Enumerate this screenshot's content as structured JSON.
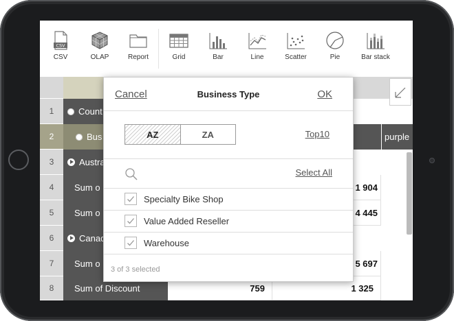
{
  "toolbar": {
    "items": [
      {
        "label": "CSV",
        "icon": "csv-icon"
      },
      {
        "label": "OLAP",
        "icon": "cube-icon"
      },
      {
        "label": "Report",
        "icon": "folder-icon"
      },
      {
        "label": "Grid",
        "icon": "grid-icon"
      },
      {
        "label": "Bar",
        "icon": "bar-chart-icon"
      },
      {
        "label": "Line",
        "icon": "line-chart-icon"
      },
      {
        "label": "Scatter",
        "icon": "scatter-chart-icon"
      },
      {
        "label": "Pie",
        "icon": "pie-chart-icon"
      },
      {
        "label": "Bar stack",
        "icon": "bar-stack-icon"
      }
    ]
  },
  "grid": {
    "row_numbers": [
      "1",
      "2",
      "3",
      "4",
      "5",
      "6",
      "7",
      "8"
    ],
    "row1_label": "Count",
    "row2_label": "Bus",
    "row3_label": "Austra",
    "row4_label": "Sum o",
    "row5_label": "Sum o",
    "row6_label": "Canad",
    "row7_label": "Sum o",
    "row8_label": "Sum of Discount",
    "header_purple": "purple",
    "row4_value": "1 904",
    "row5_value": "4 445",
    "row7_value": "5 697",
    "row8_value_a": "759",
    "row8_value_b": "1 325"
  },
  "dialog": {
    "cancel_label": "Cancel",
    "title": "Business Type",
    "ok_label": "OK",
    "sort_az": "AZ",
    "sort_za": "ZA",
    "top10_label": "Top10",
    "search_placeholder": "",
    "select_all_label": "Select All",
    "items": [
      {
        "label": "Specialty Bike Shop",
        "checked": true
      },
      {
        "label": "Value Added Reseller",
        "checked": true
      },
      {
        "label": "Warehouse",
        "checked": true
      }
    ],
    "footer": "3 of 3 selected"
  }
}
